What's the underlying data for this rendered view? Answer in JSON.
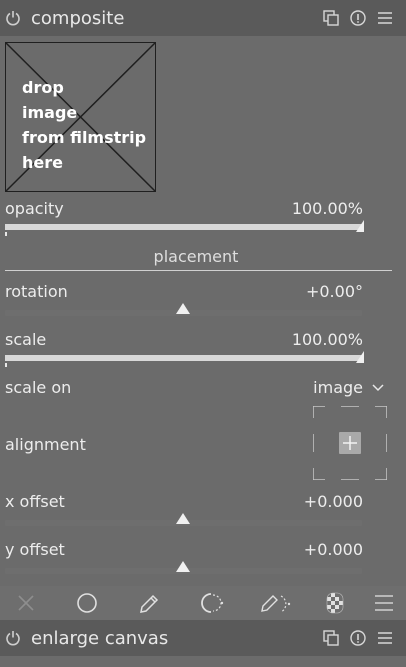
{
  "module": {
    "title": "composite",
    "drop_zone_text": "drop\nimage\nfrom filmstrip\nhere"
  },
  "opacity": {
    "label": "opacity",
    "value": "100.00%",
    "fraction": 1.0
  },
  "placement": {
    "section_title": "placement"
  },
  "rotation": {
    "label": "rotation",
    "value": "+0.00°",
    "fraction": 0.5
  },
  "scale": {
    "label": "scale",
    "value": "100.00%",
    "fraction": 1.0
  },
  "scale_on": {
    "label": "scale on",
    "value": "image"
  },
  "alignment": {
    "label": "alignment"
  },
  "x_offset": {
    "label": "x offset",
    "value": "+0.000",
    "fraction": 0.5
  },
  "y_offset": {
    "label": "y offset",
    "value": "+0.000",
    "fraction": 0.5
  },
  "next_module": {
    "title": "enlarge canvas"
  },
  "icons": {
    "header": [
      "power-icon",
      "multi-instance-icon",
      "reset-icon",
      "presets-icon"
    ],
    "blend_modes": [
      "off-icon",
      "uniform-icon",
      "drawn-mask-icon",
      "parametric-mask-icon",
      "drawn-parametric-mask-icon",
      "raster-mask-icon",
      "blend-menu-icon"
    ]
  },
  "colors": {
    "panel_bg": "#6b6b6b",
    "header_bg": "#5a5a5a",
    "slider_fill": "#d8d8d8",
    "accent": "#f0f0f0"
  }
}
